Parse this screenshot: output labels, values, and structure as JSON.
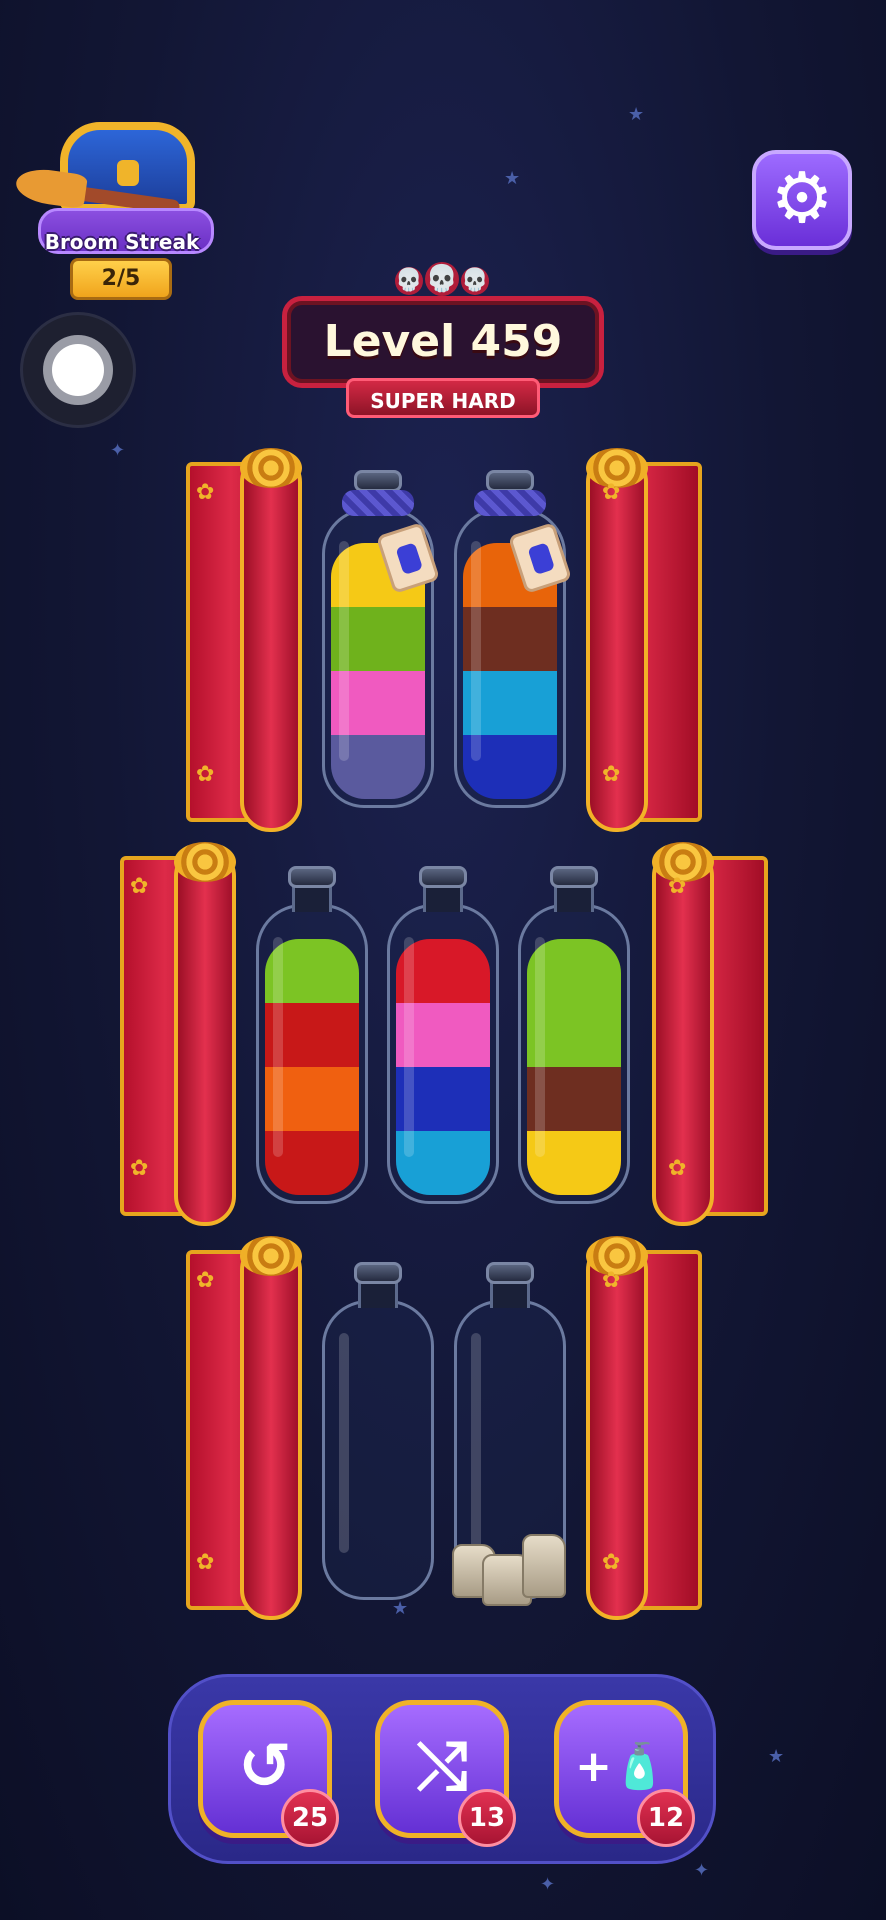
{
  "streak": {
    "title": "Broom Streak",
    "progress": "2/5"
  },
  "level": {
    "title": "Level 459",
    "difficulty": "SUPER HARD",
    "skulls": [
      "💀",
      "💀",
      "💀"
    ]
  },
  "icons": {
    "settings": "⚙",
    "undo": "↺",
    "shuffle": "⤭",
    "add_tube": "+🧴"
  },
  "tubes": [
    {
      "layers_bottom_to_top": [
        "#5a5a9e",
        "#f05ac0",
        "#6fb21c",
        "#f5c916"
      ],
      "locked": true
    },
    {
      "layers_bottom_to_top": [
        "#1d2fb8",
        "#18a0d6",
        "#6e2e20",
        "#e8640a"
      ],
      "locked": true
    },
    {
      "layers_bottom_to_top": [
        "#c81818",
        "#f06010",
        "#c81818",
        "#7cc424"
      ],
      "locked": false
    },
    {
      "layers_bottom_to_top": [
        "#18a0d6",
        "#1d2fb8",
        "#f05ac0",
        "#d81828"
      ],
      "locked": false
    },
    {
      "layers_bottom_to_top": [
        "#f5c916",
        "#6e2e20",
        "#7cc424",
        "#7cc424"
      ],
      "locked": false
    },
    {
      "layers_bottom_to_top": [],
      "locked": false
    },
    {
      "layers_bottom_to_top": [],
      "locked": false,
      "blocked_by_rocks": true
    }
  ],
  "powerups": {
    "undo_count": "25",
    "shuffle_count": "13",
    "add_tube_count": "12"
  }
}
